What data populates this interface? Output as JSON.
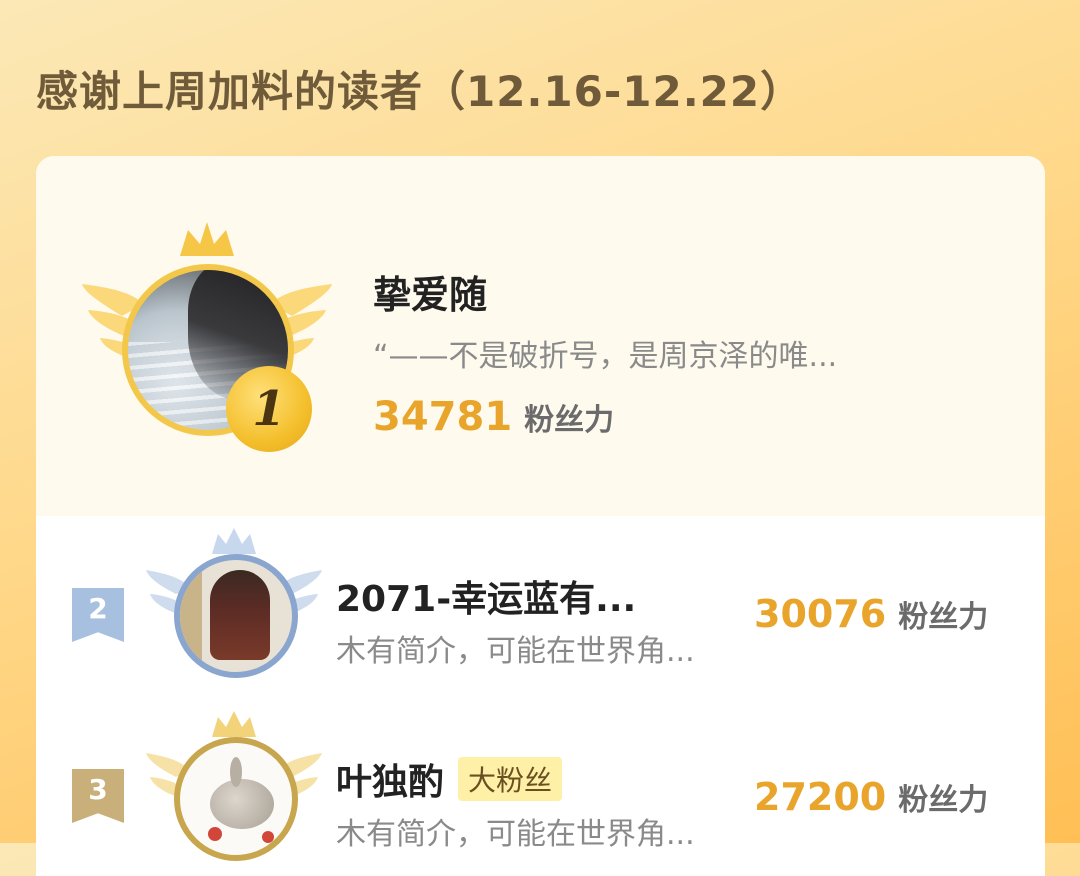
{
  "header": {
    "title": "感谢上周加料的读者（12.16-12.22）"
  },
  "colors": {
    "accent": "#e9a52b",
    "gold": "#f3c74a",
    "silver": "#9fb7d8",
    "bronze": "#c9a95a"
  },
  "leaderboard": [
    {
      "rank": "1",
      "name": "挚爱随",
      "bio": "“——不是破折号，是周京泽的唯...",
      "score": "34781",
      "score_unit": "粉丝力",
      "avatar": "woman-hair-sea-photo"
    },
    {
      "rank": "2",
      "name": "2071-幸运蓝有...",
      "bio": "木有简介，可能在世界角...",
      "score": "30076",
      "score_unit": "粉丝力",
      "avatar": "man-sitting-photo"
    },
    {
      "rank": "3",
      "name": "叶独酌",
      "badge": "大粉丝",
      "bio": "木有简介，可能在世界角...",
      "score": "27200",
      "score_unit": "粉丝力",
      "avatar": "rabbit-strawberry-photo"
    }
  ]
}
